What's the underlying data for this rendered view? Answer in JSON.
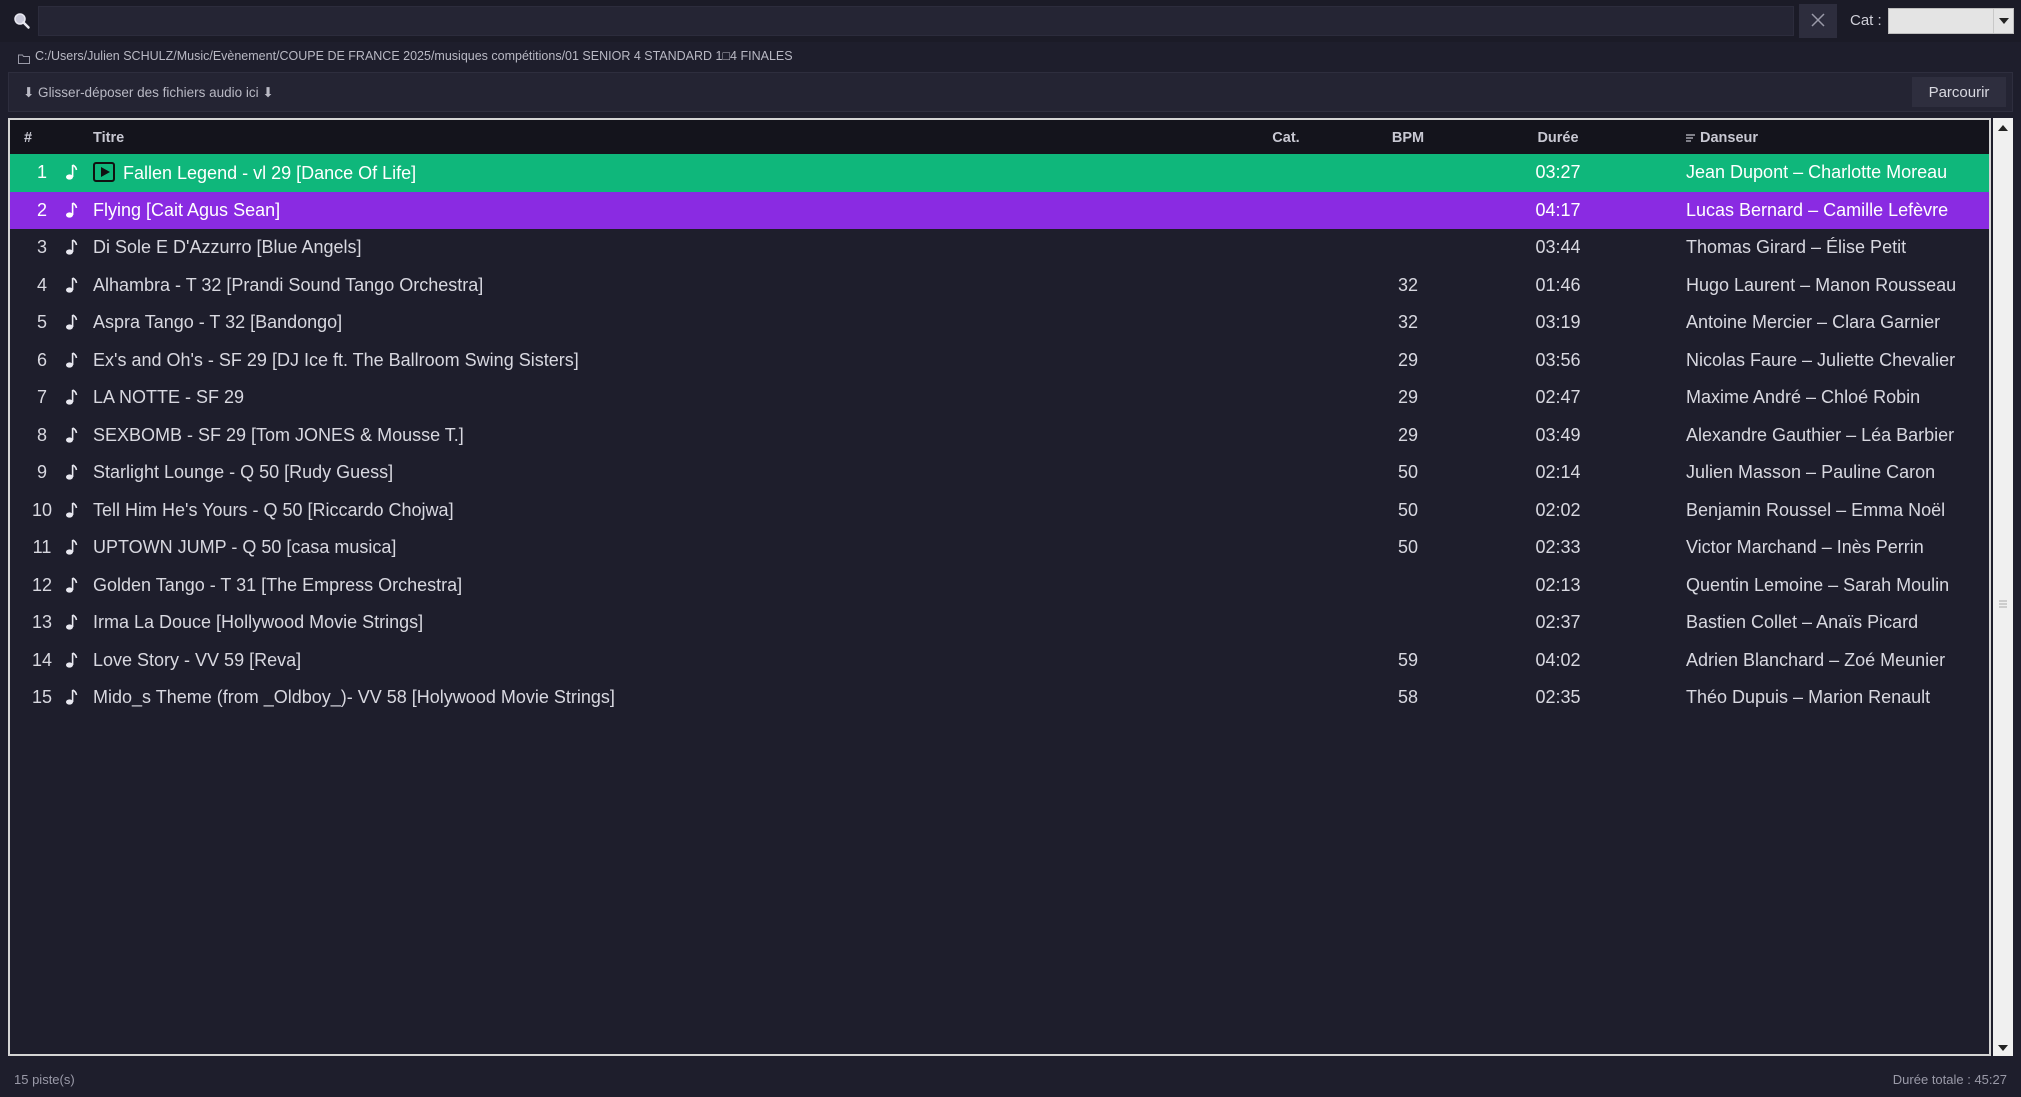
{
  "search": {
    "value": "",
    "placeholder": "",
    "cat_label": "Cat :",
    "cat_value": ""
  },
  "path": "C:/Users/Julien SCHULZ/Music/Evènement/COUPE DE FRANCE 2025/musiques compétitions/01  SENIOR 4 STANDARD 1□4 FINALES",
  "dropzone": {
    "text": "⬇ Glisser-déposer des fichiers audio ici ⬇",
    "browse_label": "Parcourir"
  },
  "table": {
    "headers": {
      "num": "#",
      "title": "Titre",
      "cat": "Cat.",
      "bpm": "BPM",
      "duration": "Durée",
      "dancer": "Danseur"
    },
    "rows": [
      {
        "num": "1",
        "title": "Fallen Legend - vl 29  [Dance Of Life]",
        "cat": "",
        "bpm": "",
        "duration": "03:27",
        "dancer": "Jean Dupont – Charlotte Moreau",
        "state": "playing"
      },
      {
        "num": "2",
        "title": "Flying  [Cait Agus Sean]",
        "cat": "",
        "bpm": "",
        "duration": "04:17",
        "dancer": "Lucas Bernard – Camille Lefèvre",
        "state": "selected"
      },
      {
        "num": "3",
        "title": "Di Sole E D'Azzurro  [Blue Angels]",
        "cat": "",
        "bpm": "",
        "duration": "03:44",
        "dancer": "Thomas Girard – Élise Petit",
        "state": ""
      },
      {
        "num": "4",
        "title": "Alhambra - T 32  [Prandi Sound Tango Orchestra]",
        "cat": "",
        "bpm": "32",
        "duration": "01:46",
        "dancer": "Hugo Laurent – Manon Rousseau",
        "state": ""
      },
      {
        "num": "5",
        "title": "Aspra Tango - T 32  [Bandongo]",
        "cat": "",
        "bpm": "32",
        "duration": "03:19",
        "dancer": "Antoine Mercier – Clara Garnier",
        "state": ""
      },
      {
        "num": "6",
        "title": "Ex's and Oh's - SF 29  [DJ Ice ft. The Ballroom Swing Sisters]",
        "cat": "",
        "bpm": "29",
        "duration": "03:56",
        "dancer": "Nicolas Faure – Juliette Chevalier",
        "state": ""
      },
      {
        "num": "7",
        "title": "LA NOTTE - SF 29",
        "cat": "",
        "bpm": "29",
        "duration": "02:47",
        "dancer": "Maxime André – Chloé Robin",
        "state": ""
      },
      {
        "num": "8",
        "title": "SEXBOMB - SF 29  [Tom JONES &  Mousse  T.]",
        "cat": "",
        "bpm": "29",
        "duration": "03:49",
        "dancer": "Alexandre Gauthier – Léa Barbier",
        "state": ""
      },
      {
        "num": "9",
        "title": "Starlight Lounge - Q 50  [Rudy Guess]",
        "cat": "",
        "bpm": "50",
        "duration": "02:14",
        "dancer": "Julien Masson – Pauline Caron",
        "state": ""
      },
      {
        "num": "10",
        "title": "Tell Him He's Yours - Q 50  [Riccardo Chojwa]",
        "cat": "",
        "bpm": "50",
        "duration": "02:02",
        "dancer": "Benjamin Roussel – Emma Noël",
        "state": ""
      },
      {
        "num": "11",
        "title": "UPTOWN JUMP - Q 50  [casa musica]",
        "cat": "",
        "bpm": "50",
        "duration": "02:33",
        "dancer": "Victor Marchand – Inès Perrin",
        "state": ""
      },
      {
        "num": "12",
        "title": "Golden Tango   - T 31  [The Empress Orchestra]",
        "cat": "",
        "bpm": "",
        "duration": "02:13",
        "dancer": "Quentin Lemoine – Sarah Moulin",
        "state": ""
      },
      {
        "num": "13",
        "title": "Irma La Douce  [Hollywood Movie Strings]",
        "cat": "",
        "bpm": "",
        "duration": "02:37",
        "dancer": "Bastien Collet – Anaïs Picard",
        "state": ""
      },
      {
        "num": "14",
        "title": "Love Story - VV 59  [Reva]",
        "cat": "",
        "bpm": "59",
        "duration": "04:02",
        "dancer": "Adrien Blanchard – Zoé Meunier",
        "state": ""
      },
      {
        "num": "15",
        "title": "Mido_s Theme (from _Oldboy_)- VV 58  [Holywood Movie Strings]",
        "cat": "",
        "bpm": "58",
        "duration": "02:35",
        "dancer": "Théo Dupuis – Marion Renault",
        "state": ""
      }
    ]
  },
  "status": {
    "track_count": "15 piste(s)",
    "total_duration": "Durée totale : 45:27"
  },
  "colors": {
    "background": "#1e1e2c",
    "playing_row": "#0fb77b",
    "selected_row": "#8a2be2",
    "header": "#14141c"
  },
  "icons": {
    "search": "search-icon",
    "clear": "close-icon",
    "folder": "folder-icon",
    "note": "music-note-icon",
    "play": "play-icon",
    "sort": "sort-icon"
  }
}
